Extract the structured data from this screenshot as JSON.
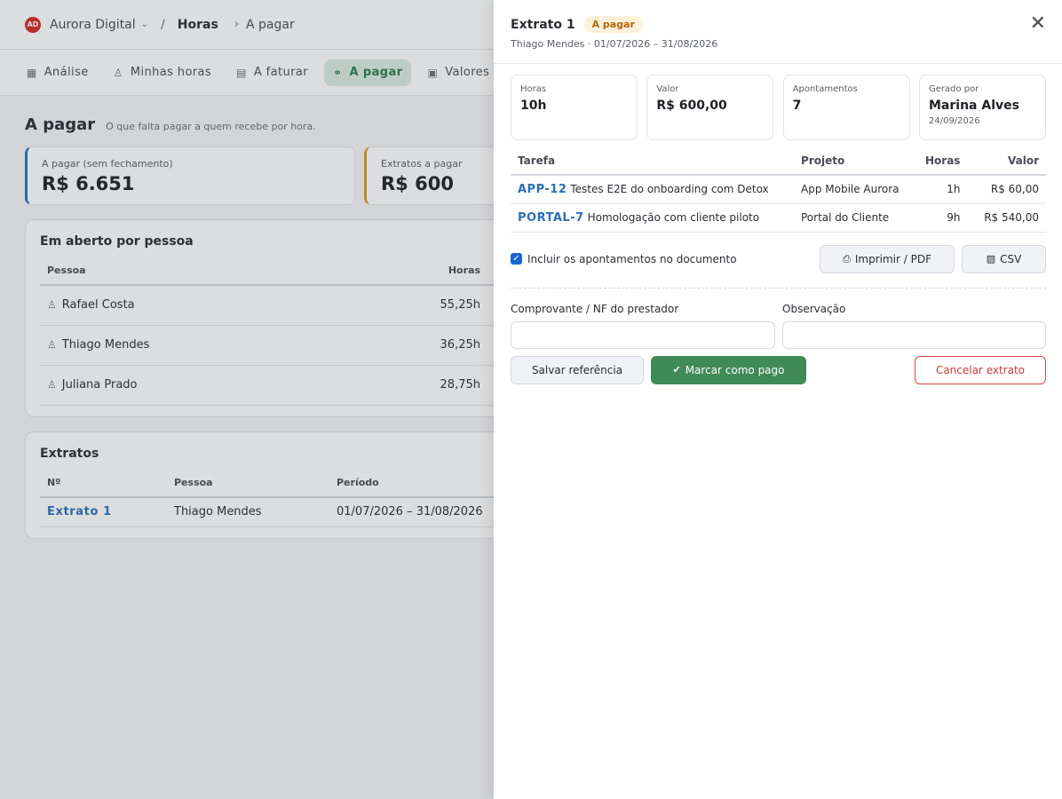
{
  "header": {
    "org_logo": "AD",
    "org_name": "Aurora Digital",
    "section": "Horas",
    "page": "A pagar"
  },
  "tabs": [
    {
      "label": "Análise",
      "icon": "table-icon"
    },
    {
      "label": "Minhas horas",
      "icon": "user-icon"
    },
    {
      "label": "A faturar",
      "icon": "document-icon"
    },
    {
      "label": "A pagar",
      "icon": "handshake-icon",
      "active": true
    },
    {
      "label": "Valores",
      "icon": "money-icon"
    }
  ],
  "page": {
    "title": "A pagar",
    "subtitle": "O que falta pagar a quem recebe por hora."
  },
  "kpis": [
    {
      "label": "A pagar (sem fechamento)",
      "value": "R$ 6.651",
      "accent": "#2c6fb5"
    },
    {
      "label": "Extratos a pagar",
      "value": "R$ 600",
      "accent": "#e09a1f"
    }
  ],
  "open_by_person": {
    "title": "Em aberto por pessoa",
    "columns": [
      "Pessoa",
      "Horas"
    ],
    "rows": [
      {
        "person": "Rafael Costa",
        "hours": "55,25h"
      },
      {
        "person": "Thiago Mendes",
        "hours": "36,25h"
      },
      {
        "person": "Juliana Prado",
        "hours": "28,75h"
      }
    ]
  },
  "statements": {
    "title": "Extratos",
    "columns": [
      "Nº",
      "Pessoa",
      "Período"
    ],
    "rows": [
      {
        "number": "Extrato 1",
        "person": "Thiago Mendes",
        "period": "01/07/2026 – 31/08/2026"
      }
    ]
  },
  "drawer": {
    "title": "Extrato 1",
    "status": "A pagar",
    "subtitle": "Thiago Mendes · 01/07/2026 – 31/08/2026",
    "stats": [
      {
        "label": "Horas",
        "value": "10h"
      },
      {
        "label": "Valor",
        "value": "R$ 600,00"
      },
      {
        "label": "Apontamentos",
        "value": "7"
      },
      {
        "label": "Gerado por",
        "value": "Marina Alves",
        "foot": "24/09/2026"
      }
    ],
    "table": {
      "columns": [
        "Tarefa",
        "Projeto",
        "Horas",
        "Valor"
      ],
      "rows": [
        {
          "key": "APP-12",
          "task": "Testes E2E do onboarding com Detox",
          "project": "App Mobile Aurora",
          "hours": "1h",
          "value": "R$ 60,00"
        },
        {
          "key": "PORTAL-7",
          "task": "Homologação com cliente piloto",
          "project": "Portal do Cliente",
          "hours": "9h",
          "value": "R$ 540,00"
        }
      ]
    },
    "include_entries_label": "Incluir os apontamentos no documento",
    "include_entries_checked": true,
    "print_label": "Imprimir / PDF",
    "csv_label": "CSV",
    "receipt_label": "Comprovante / NF do prestador",
    "receipt_value": "",
    "notes_label": "Observação",
    "notes_value": "",
    "save_label": "Salvar referência",
    "paid_label": "Marcar como pago",
    "cancel_label": "Cancelar extrato",
    "colors": {
      "paid": "#3f8a57",
      "cancel": "#d64545",
      "status_badge": "#fdf1dc"
    }
  }
}
